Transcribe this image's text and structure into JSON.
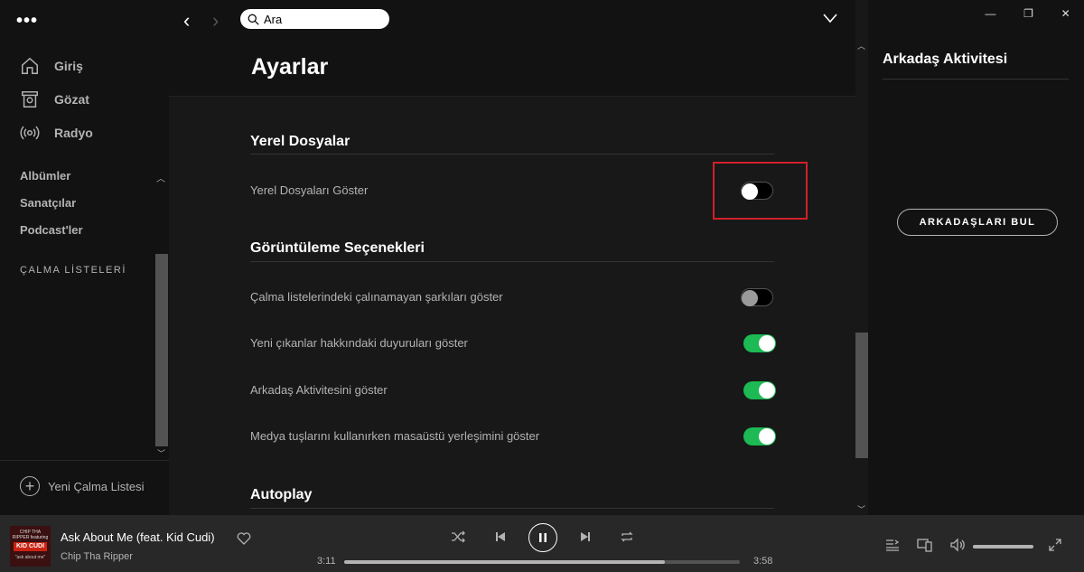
{
  "sidebar": {
    "nav": [
      {
        "label": "Giriş",
        "icon": "home-icon"
      },
      {
        "label": "Gözat",
        "icon": "browse-icon"
      },
      {
        "label": "Radyo",
        "icon": "radio-icon"
      }
    ],
    "library": [
      "Albümler",
      "Sanatçılar",
      "Podcast'ler"
    ],
    "playlists_title": "ÇALMA LİSTELERİ",
    "new_playlist": "Yeni Çalma Listesi"
  },
  "topbar": {
    "search_value": "Ara"
  },
  "settings": {
    "title": "Ayarlar",
    "sections": [
      {
        "heading": "Yerel Dosyalar",
        "rows": [
          {
            "label": "Yerel Dosyaları Göster",
            "enabled": false
          }
        ]
      },
      {
        "heading": "Görüntüleme Seçenekleri",
        "rows": [
          {
            "label": "Çalma listelerindeki çalınamayan şarkıları göster",
            "enabled": false
          },
          {
            "label": "Yeni çıkanlar hakkındaki duyuruları göster",
            "enabled": true
          },
          {
            "label": "Arkadaş Aktivitesini göster",
            "enabled": true
          },
          {
            "label": "Medya tuşlarını kullanırken masaüstü yerleşimini göster",
            "enabled": true
          }
        ]
      },
      {
        "heading": "Autoplay",
        "rows": []
      }
    ]
  },
  "friends": {
    "title": "Arkadaş Aktivitesi",
    "find_button": "ARKADAŞLARI BUL"
  },
  "player": {
    "cover_text_top": "CHIP THA RIPPER featuring",
    "cover_text_mid": "KID CUDI",
    "cover_text_bottom": "\"ask about me\"",
    "song": "Ask About Me (feat. Kid Cudi)",
    "artist": "Chip Tha Ripper",
    "elapsed": "3:11",
    "duration": "3:58",
    "progress": 0.81,
    "volume": 1.0
  },
  "colors": {
    "accent": "#1db954",
    "highlight": "#d0202a",
    "background": "#181818"
  }
}
